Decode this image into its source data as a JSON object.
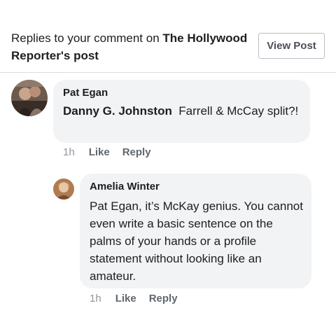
{
  "header": {
    "title_prefix": "Replies to your comment on ",
    "page_name": "The Hollywood Reporter",
    "title_suffix": "'s post",
    "view_post_label": "View Post"
  },
  "comment": {
    "author": "Pat Egan",
    "mention": "Danny G. Johnston",
    "text": "Farrell & McCay split?!",
    "time": "1h",
    "like_label": "Like",
    "reply_label": "Reply"
  },
  "reply": {
    "author": "Amelia Winter",
    "text": "Pat Egan, it’s McKay genius. You cannot even write a basic sentence on the palms of your hands or a profile statement without looking like an amateur.",
    "time": "1h",
    "like_label": "Like",
    "reply_label": "Reply"
  },
  "colors": {
    "bubble": "#f2f3f5",
    "divider": "#dadde1",
    "meta": "#90949c"
  }
}
